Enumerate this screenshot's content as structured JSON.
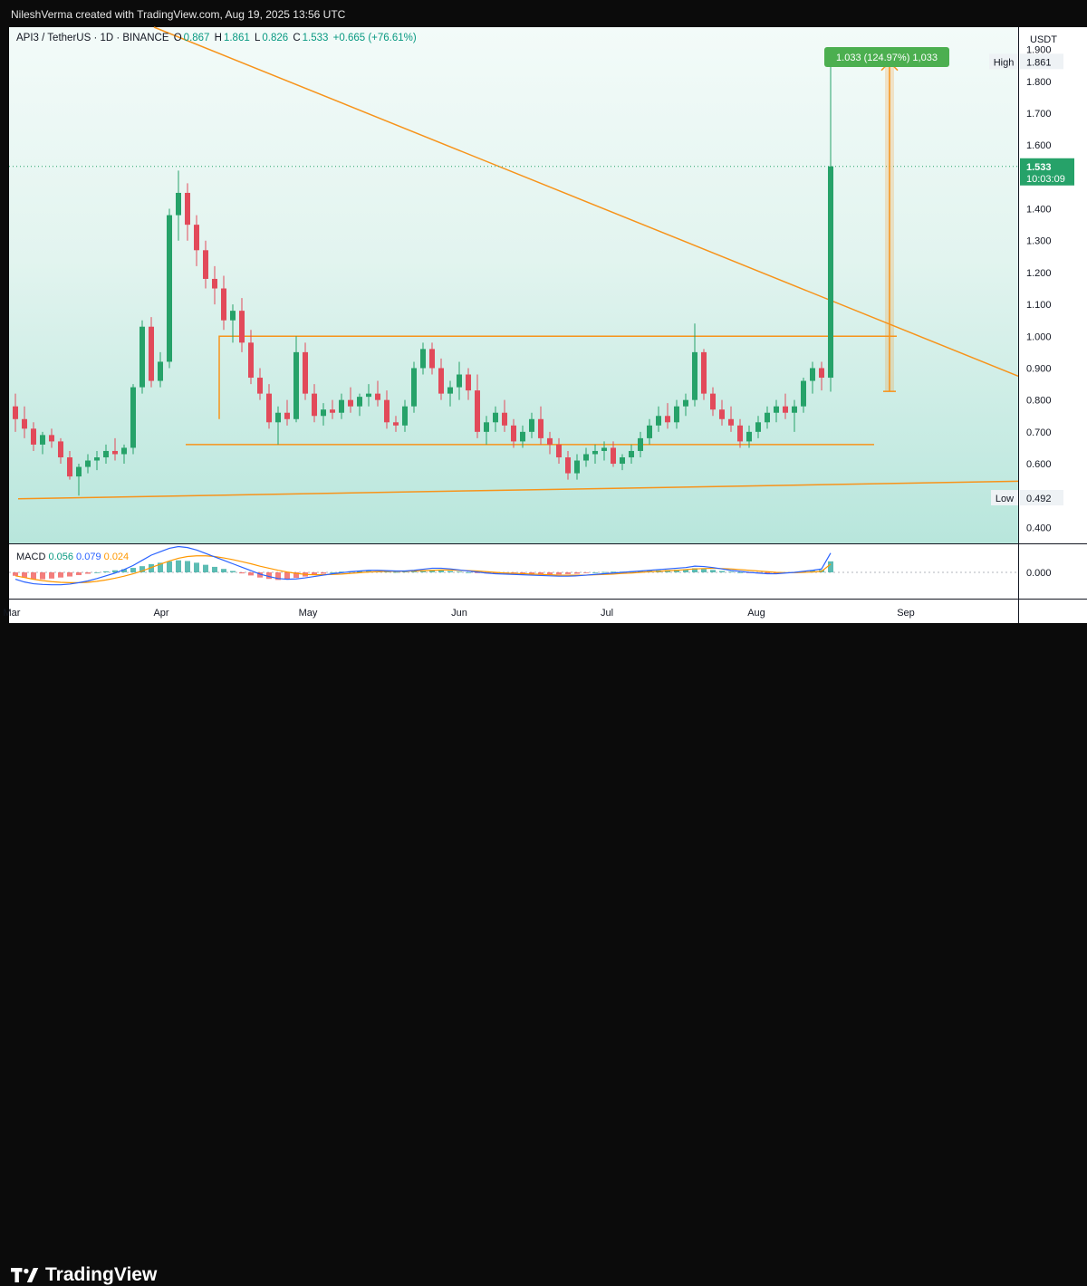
{
  "attribution": "NileshVerma created with TradingView.com, Aug 19, 2025 13:56 UTC",
  "ticker": {
    "symbol": "API3 / TetherUS · 1D · BINANCE",
    "open_label": "O",
    "open": "0.867",
    "high_label": "H",
    "high": "1.861",
    "low_label": "L",
    "low": "0.826",
    "close_label": "C",
    "close": "1.533",
    "change": "+0.665 (+76.61%)"
  },
  "currency": "USDT",
  "price_tag": {
    "value": "1.533",
    "countdown": "10:03:09"
  },
  "high_tag": {
    "label": "High",
    "value": "1.861"
  },
  "low_tag": {
    "label": "Low",
    "value": "0.492"
  },
  "measure_label": "1.033 (124.97%) 1,033",
  "macd": {
    "name": "MACD",
    "v1": "0.056",
    "v2": "0.079",
    "v3": "0.024",
    "axis_value": "0.000"
  },
  "brand": "TradingView",
  "colors": {
    "up": "#26a269",
    "down": "#e24a5a",
    "trendline": "#f7931a",
    "macd": "#2962ff",
    "signal": "#ff9800",
    "tag_green": "#4caf50"
  },
  "chart_data": {
    "type": "candlestick",
    "y_axis": {
      "min": 0.35,
      "max": 1.97,
      "ticks": [
        0.4,
        0.5,
        0.6,
        0.7,
        0.8,
        0.9,
        1.0,
        1.1,
        1.2,
        1.3,
        1.4,
        1.5,
        1.6,
        1.7,
        1.8,
        1.9
      ]
    },
    "x_axis": {
      "labels": [
        "Mar",
        "Apr",
        "May",
        "Jun",
        "Jul",
        "Aug",
        "Sep"
      ]
    },
    "resistance": 1.0,
    "support": 0.66,
    "candles": [
      [
        0.78,
        0.82,
        0.7,
        0.74
      ],
      [
        0.74,
        0.78,
        0.68,
        0.71
      ],
      [
        0.71,
        0.73,
        0.64,
        0.66
      ],
      [
        0.66,
        0.7,
        0.63,
        0.69
      ],
      [
        0.69,
        0.71,
        0.65,
        0.67
      ],
      [
        0.67,
        0.68,
        0.6,
        0.62
      ],
      [
        0.62,
        0.64,
        0.55,
        0.56
      ],
      [
        0.56,
        0.6,
        0.5,
        0.59
      ],
      [
        0.59,
        0.63,
        0.57,
        0.61
      ],
      [
        0.61,
        0.64,
        0.58,
        0.62
      ],
      [
        0.62,
        0.66,
        0.6,
        0.64
      ],
      [
        0.64,
        0.68,
        0.61,
        0.63
      ],
      [
        0.63,
        0.66,
        0.6,
        0.65
      ],
      [
        0.65,
        0.85,
        0.63,
        0.84
      ],
      [
        0.84,
        1.05,
        0.82,
        1.03
      ],
      [
        1.03,
        1.06,
        0.84,
        0.86
      ],
      [
        0.86,
        0.95,
        0.84,
        0.92
      ],
      [
        0.92,
        1.4,
        0.9,
        1.38
      ],
      [
        1.38,
        1.52,
        1.3,
        1.45
      ],
      [
        1.45,
        1.48,
        1.3,
        1.35
      ],
      [
        1.35,
        1.38,
        1.22,
        1.27
      ],
      [
        1.27,
        1.3,
        1.15,
        1.18
      ],
      [
        1.18,
        1.22,
        1.1,
        1.15
      ],
      [
        1.15,
        1.19,
        1.02,
        1.05
      ],
      [
        1.05,
        1.1,
        0.98,
        1.08
      ],
      [
        1.08,
        1.12,
        0.95,
        0.98
      ],
      [
        0.98,
        1.02,
        0.85,
        0.87
      ],
      [
        0.87,
        0.9,
        0.8,
        0.82
      ],
      [
        0.82,
        0.85,
        0.71,
        0.73
      ],
      [
        0.73,
        0.78,
        0.66,
        0.76
      ],
      [
        0.76,
        0.8,
        0.72,
        0.74
      ],
      [
        0.74,
        1.0,
        0.73,
        0.95
      ],
      [
        0.95,
        0.98,
        0.8,
        0.82
      ],
      [
        0.82,
        0.85,
        0.73,
        0.75
      ],
      [
        0.75,
        0.79,
        0.72,
        0.77
      ],
      [
        0.77,
        0.8,
        0.74,
        0.76
      ],
      [
        0.76,
        0.82,
        0.74,
        0.8
      ],
      [
        0.8,
        0.84,
        0.76,
        0.78
      ],
      [
        0.78,
        0.82,
        0.75,
        0.81
      ],
      [
        0.81,
        0.85,
        0.78,
        0.82
      ],
      [
        0.82,
        0.86,
        0.78,
        0.8
      ],
      [
        0.8,
        0.83,
        0.71,
        0.73
      ],
      [
        0.73,
        0.75,
        0.7,
        0.72
      ],
      [
        0.72,
        0.8,
        0.7,
        0.78
      ],
      [
        0.78,
        0.92,
        0.76,
        0.9
      ],
      [
        0.9,
        0.98,
        0.88,
        0.96
      ],
      [
        0.96,
        0.98,
        0.88,
        0.9
      ],
      [
        0.9,
        0.93,
        0.8,
        0.82
      ],
      [
        0.82,
        0.86,
        0.78,
        0.84
      ],
      [
        0.84,
        0.92,
        0.8,
        0.88
      ],
      [
        0.88,
        0.9,
        0.8,
        0.83
      ],
      [
        0.83,
        0.88,
        0.68,
        0.7
      ],
      [
        0.7,
        0.75,
        0.66,
        0.73
      ],
      [
        0.73,
        0.78,
        0.7,
        0.76
      ],
      [
        0.76,
        0.8,
        0.7,
        0.72
      ],
      [
        0.72,
        0.74,
        0.65,
        0.67
      ],
      [
        0.67,
        0.72,
        0.65,
        0.7
      ],
      [
        0.7,
        0.76,
        0.68,
        0.74
      ],
      [
        0.74,
        0.78,
        0.66,
        0.68
      ],
      [
        0.68,
        0.7,
        0.63,
        0.66
      ],
      [
        0.66,
        0.68,
        0.6,
        0.62
      ],
      [
        0.62,
        0.64,
        0.55,
        0.57
      ],
      [
        0.57,
        0.63,
        0.55,
        0.61
      ],
      [
        0.61,
        0.65,
        0.59,
        0.63
      ],
      [
        0.63,
        0.66,
        0.6,
        0.64
      ],
      [
        0.64,
        0.67,
        0.61,
        0.65
      ],
      [
        0.65,
        0.67,
        0.59,
        0.6
      ],
      [
        0.6,
        0.63,
        0.58,
        0.62
      ],
      [
        0.62,
        0.66,
        0.6,
        0.64
      ],
      [
        0.64,
        0.7,
        0.62,
        0.68
      ],
      [
        0.68,
        0.74,
        0.66,
        0.72
      ],
      [
        0.72,
        0.78,
        0.7,
        0.75
      ],
      [
        0.75,
        0.79,
        0.71,
        0.73
      ],
      [
        0.73,
        0.8,
        0.71,
        0.78
      ],
      [
        0.78,
        0.82,
        0.75,
        0.8
      ],
      [
        0.8,
        1.04,
        0.78,
        0.95
      ],
      [
        0.95,
        0.96,
        0.8,
        0.82
      ],
      [
        0.82,
        0.84,
        0.75,
        0.77
      ],
      [
        0.77,
        0.8,
        0.72,
        0.74
      ],
      [
        0.74,
        0.78,
        0.7,
        0.72
      ],
      [
        0.72,
        0.74,
        0.65,
        0.67
      ],
      [
        0.67,
        0.72,
        0.65,
        0.7
      ],
      [
        0.7,
        0.75,
        0.68,
        0.73
      ],
      [
        0.73,
        0.78,
        0.71,
        0.76
      ],
      [
        0.76,
        0.8,
        0.73,
        0.78
      ],
      [
        0.78,
        0.82,
        0.74,
        0.76
      ],
      [
        0.76,
        0.8,
        0.7,
        0.78
      ],
      [
        0.78,
        0.87,
        0.76,
        0.86
      ],
      [
        0.86,
        0.92,
        0.82,
        0.9
      ],
      [
        0.9,
        0.92,
        0.83,
        0.87
      ],
      [
        0.87,
        1.861,
        0.826,
        1.533
      ]
    ],
    "macd_hist": [
      -0.01,
      -0.015,
      -0.02,
      -0.02,
      -0.018,
      -0.015,
      -0.012,
      -0.008,
      -0.004,
      0.0,
      0.003,
      0.006,
      0.009,
      0.013,
      0.018,
      0.024,
      0.028,
      0.032,
      0.035,
      0.033,
      0.028,
      0.022,
      0.016,
      0.01,
      0.004,
      -0.003,
      -0.009,
      -0.015,
      -0.019,
      -0.022,
      -0.02,
      -0.016,
      -0.012,
      -0.008,
      -0.004,
      0.0,
      0.002,
      0.003,
      0.004,
      0.004,
      0.003,
      0.002,
      0.001,
      0.002,
      0.004,
      0.006,
      0.007,
      0.006,
      0.004,
      0.002,
      0.0,
      -0.002,
      -0.003,
      -0.003,
      -0.002,
      -0.002,
      -0.003,
      -0.004,
      -0.005,
      -0.006,
      -0.006,
      -0.005,
      -0.004,
      -0.002,
      0.0,
      0.001,
      0.002,
      0.002,
      0.003,
      0.004,
      0.005,
      0.006,
      0.007,
      0.008,
      0.009,
      0.012,
      0.01,
      0.007,
      0.004,
      0.002,
      0.0,
      -0.002,
      -0.003,
      -0.004,
      -0.003,
      -0.001,
      0.001,
      0.003,
      0.005,
      0.007,
      0.032
    ],
    "macd_line": [
      -0.02,
      -0.028,
      -0.033,
      -0.035,
      -0.036,
      -0.036,
      -0.034,
      -0.03,
      -0.025,
      -0.018,
      -0.01,
      -0.002,
      0.008,
      0.02,
      0.035,
      0.05,
      0.06,
      0.07,
      0.075,
      0.072,
      0.065,
      0.055,
      0.045,
      0.035,
      0.025,
      0.015,
      0.005,
      -0.005,
      -0.012,
      -0.018,
      -0.02,
      -0.019,
      -0.016,
      -0.012,
      -0.008,
      -0.004,
      -0.001,
      0.002,
      0.004,
      0.006,
      0.006,
      0.005,
      0.004,
      0.004,
      0.006,
      0.009,
      0.012,
      0.012,
      0.01,
      0.007,
      0.004,
      0.001,
      -0.002,
      -0.004,
      -0.005,
      -0.006,
      -0.007,
      -0.008,
      -0.009,
      -0.01,
      -0.011,
      -0.011,
      -0.01,
      -0.008,
      -0.006,
      -0.004,
      -0.002,
      0.0,
      0.002,
      0.004,
      0.006,
      0.008,
      0.01,
      0.012,
      0.014,
      0.018,
      0.017,
      0.014,
      0.01,
      0.006,
      0.003,
      0.0,
      -0.002,
      -0.004,
      -0.004,
      -0.002,
      0.0,
      0.003,
      0.006,
      0.01,
      0.056
    ],
    "signal_line": [
      -0.01,
      -0.015,
      -0.02,
      -0.024,
      -0.027,
      -0.029,
      -0.03,
      -0.03,
      -0.029,
      -0.026,
      -0.022,
      -0.017,
      -0.011,
      -0.004,
      0.004,
      0.014,
      0.024,
      0.033,
      0.041,
      0.046,
      0.048,
      0.048,
      0.046,
      0.042,
      0.037,
      0.031,
      0.025,
      0.018,
      0.012,
      0.006,
      0.001,
      -0.003,
      -0.006,
      -0.007,
      -0.007,
      -0.006,
      -0.005,
      -0.003,
      -0.001,
      0.001,
      0.002,
      0.003,
      0.003,
      0.003,
      0.004,
      0.005,
      0.006,
      0.007,
      0.007,
      0.006,
      0.005,
      0.004,
      0.002,
      0.0,
      -0.002,
      -0.003,
      -0.004,
      -0.005,
      -0.006,
      -0.007,
      -0.008,
      -0.008,
      -0.008,
      -0.008,
      -0.007,
      -0.006,
      -0.005,
      -0.003,
      -0.002,
      0.0,
      0.002,
      0.003,
      0.005,
      0.006,
      0.008,
      0.01,
      0.011,
      0.012,
      0.011,
      0.01,
      0.008,
      0.006,
      0.004,
      0.002,
      0.0,
      -0.001,
      -0.001,
      0.0,
      0.001,
      0.003,
      0.024
    ]
  }
}
